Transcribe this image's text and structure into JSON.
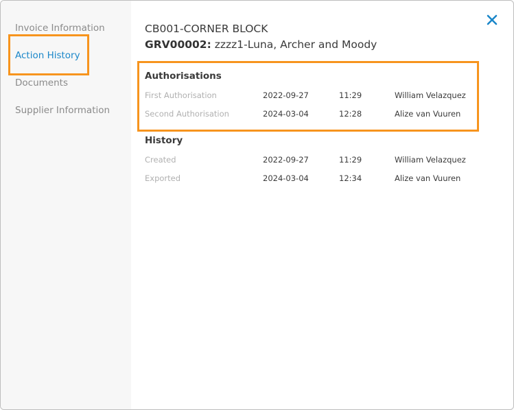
{
  "sidebar": {
    "items": [
      {
        "label": "Invoice Information",
        "active": false
      },
      {
        "label": "Action History",
        "active": true
      },
      {
        "label": "Documents",
        "active": false
      },
      {
        "label": "Supplier Information",
        "active": false
      }
    ]
  },
  "header": {
    "title": "CB001-CORNER BLOCK",
    "grv_code": "GRV00002:",
    "supplier": "zzzz1-Luna, Archer and Moody"
  },
  "authorisations": {
    "title": "Authorisations",
    "rows": [
      {
        "label": "First Authorisation",
        "date": "2022-09-27",
        "time": "11:29",
        "user": "William Velazquez"
      },
      {
        "label": "Second Authorisation",
        "date": "2024-03-04",
        "time": "12:28",
        "user": "Alize van Vuuren"
      }
    ]
  },
  "history": {
    "title": "History",
    "rows": [
      {
        "label": "Created",
        "date": "2022-09-27",
        "time": "11:29",
        "user": "William Velazquez"
      },
      {
        "label": "Exported",
        "date": "2024-03-04",
        "time": "12:34",
        "user": "Alize van Vuuren"
      }
    ]
  },
  "colors": {
    "accent": "#1b87c9",
    "highlight": "#f7941d",
    "muted_text": "#8a8a8a",
    "sidebar_bg": "#f7f7f7"
  },
  "icons": {
    "close": "close-icon"
  }
}
